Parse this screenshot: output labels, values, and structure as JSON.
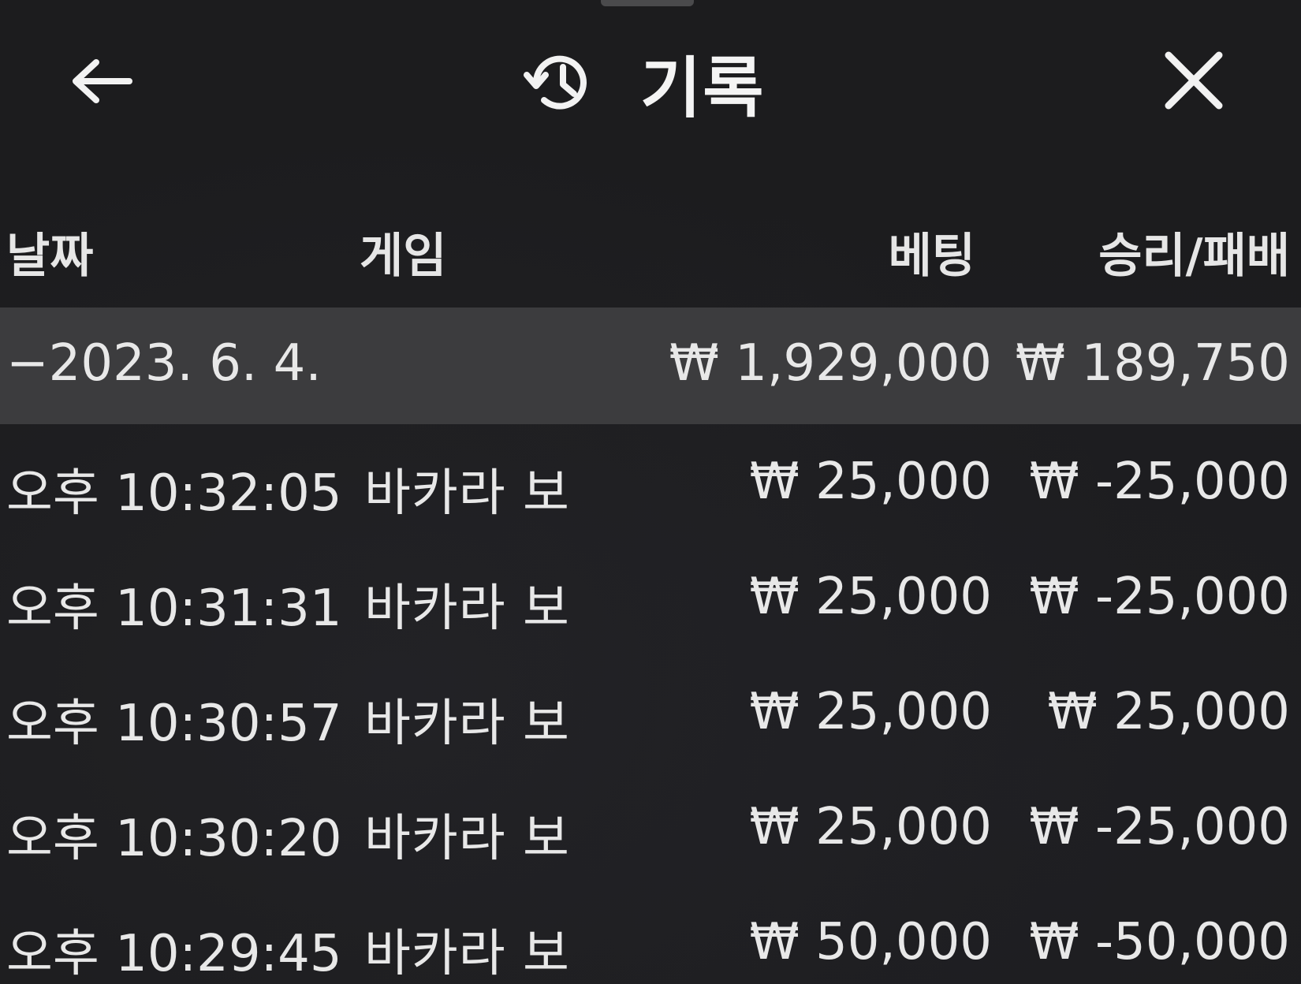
{
  "header": {
    "title": "기록",
    "back_icon": "arrow-left-icon",
    "history_icon": "history-icon",
    "close_icon": "close-icon"
  },
  "columns": {
    "date": "날짜",
    "game": "게임",
    "bet": "베팅",
    "result": "승리/패배"
  },
  "summary": {
    "date": "−2023. 6. 4.",
    "bet": "₩ 1,929,000",
    "result": "₩ 189,750"
  },
  "rows": [
    {
      "time": "오후 10:32:05",
      "game": "바카라 보",
      "bet": "₩ 25,000",
      "result": "₩ -25,000"
    },
    {
      "time": "오후 10:31:31",
      "game": "바카라 보",
      "bet": "₩ 25,000",
      "result": "₩ -25,000"
    },
    {
      "time": "오후 10:30:57",
      "game": "바카라 보",
      "bet": "₩ 25,000",
      "result": "₩ 25,000"
    },
    {
      "time": "오후 10:30:20",
      "game": "바카라 보",
      "bet": "₩ 25,000",
      "result": "₩ -25,000"
    },
    {
      "time": "오후 10:29:45",
      "game": "바카라 보",
      "bet": "₩ 50,000",
      "result": "₩ -50,000"
    }
  ],
  "colors": {
    "background": "#1c1c1e",
    "summary_row": "#3c3c3e",
    "text": "#ededed"
  }
}
